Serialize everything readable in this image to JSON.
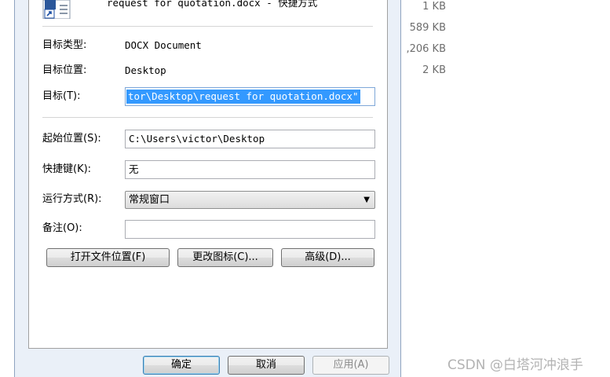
{
  "header": {
    "file_name": "request for quotation.docx - 快捷方式"
  },
  "fields": {
    "target_type": {
      "label": "目标类型:",
      "value": "DOCX Document"
    },
    "target_location": {
      "label": "目标位置:",
      "value": "Desktop"
    },
    "target": {
      "label": "目标(T):",
      "value": "tor\\Desktop\\request for quotation.docx\""
    },
    "start_in": {
      "label": "起始位置(S):",
      "value": "C:\\Users\\victor\\Desktop"
    },
    "shortcut_key": {
      "label": "快捷键(K):",
      "value": "无"
    },
    "run": {
      "label": "运行方式(R):",
      "value": "常规窗口"
    },
    "comment": {
      "label": "备注(O):",
      "value": ""
    }
  },
  "buttons": {
    "open_location": "打开文件位置(F)",
    "change_icon": "更改图标(C)...",
    "advanced": "高级(D)...",
    "ok": "确定",
    "cancel": "取消",
    "apply": "应用(A)"
  },
  "background_list": {
    "sizes": [
      "1 KB",
      "589 KB",
      ",206 KB",
      "2 KB"
    ]
  },
  "watermark": "CSDN @白塔河冲浪手",
  "colors": {
    "selection": "#3399ff",
    "dialog_background": "#eaf0f8"
  },
  "icons": {
    "file_icon": "word-document-shortcut-icon",
    "dropdown": "triangle-down-icon"
  }
}
